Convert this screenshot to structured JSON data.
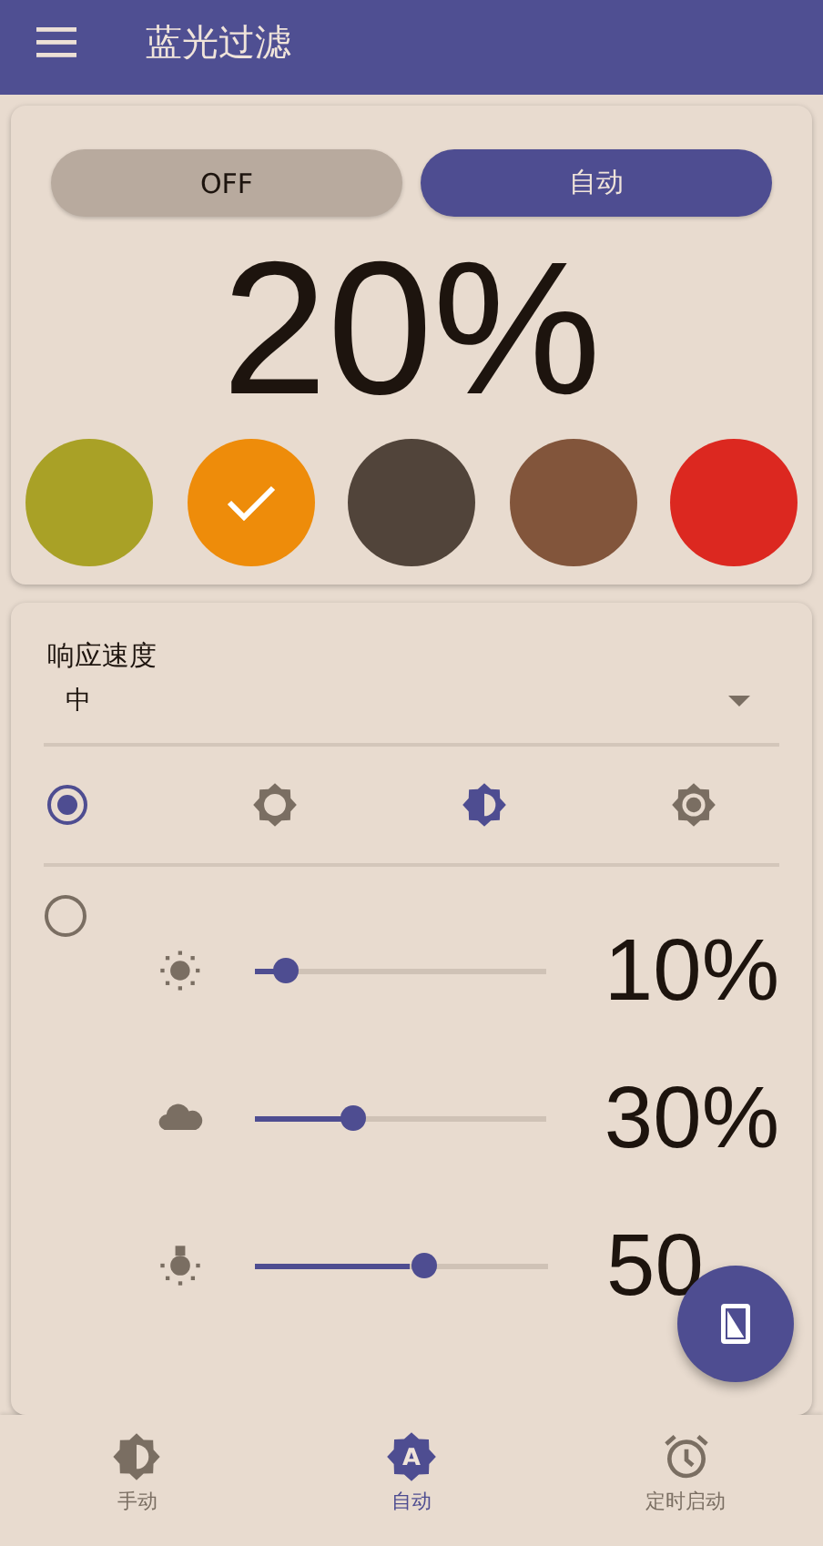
{
  "app_bar": {
    "title": "蓝光过滤"
  },
  "mode_toggle": [
    {
      "label": "OFF",
      "selected": false
    },
    {
      "label": "自动",
      "selected": true
    }
  ],
  "intensity": "20%",
  "colors": [
    {
      "color": "#a9a126",
      "selected": false
    },
    {
      "color": "#ee8c0a",
      "selected": true
    },
    {
      "color": "#51443a",
      "selected": false
    },
    {
      "color": "#82553b",
      "selected": false
    },
    {
      "color": "#dc2820",
      "selected": false
    }
  ],
  "response_speed": {
    "label": "响应速度",
    "value": "中"
  },
  "profiles": [
    {
      "kind": "icons",
      "selected": true,
      "icons": [
        {
          "kind": "low",
          "selected": false
        },
        {
          "kind": "half",
          "selected": true
        },
        {
          "kind": "high",
          "selected": false
        }
      ]
    },
    {
      "kind": "sliders",
      "selected": false,
      "sliders": [
        {
          "kind": "sun",
          "level": 0.1,
          "reading": "10%"
        },
        {
          "kind": "cloud",
          "level": 0.31,
          "reading": "30%"
        },
        {
          "kind": "bulb",
          "level": 0.53,
          "reading": "50"
        }
      ]
    }
  ],
  "bottom_nav": [
    {
      "label": "手动",
      "kind": "half",
      "selected": false
    },
    {
      "label": "自动",
      "kind": "auto",
      "icon_letter": "A",
      "selected": true
    },
    {
      "label": "定时启动",
      "kind": "alarm",
      "selected": false
    }
  ]
}
